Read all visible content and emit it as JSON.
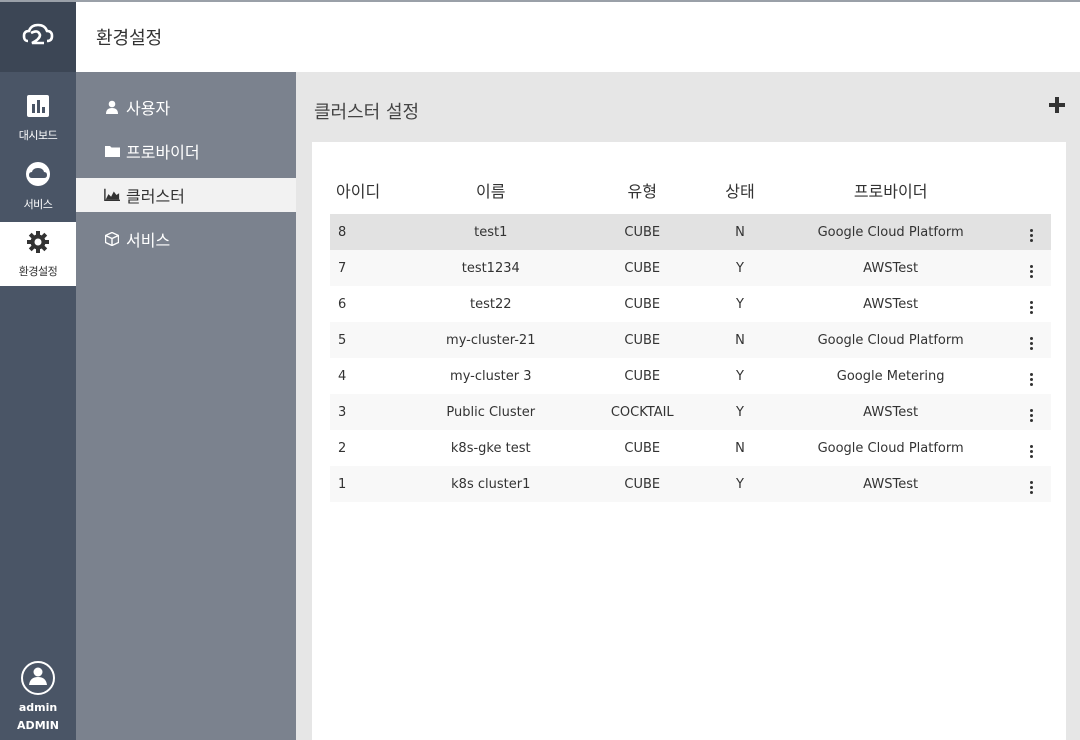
{
  "app": {
    "page_title": "환경설정"
  },
  "rail": {
    "items": [
      {
        "label": "대시보드",
        "icon": "bar-chart-icon"
      },
      {
        "label": "서비스",
        "icon": "cloud-icon"
      },
      {
        "label": "환경설정",
        "icon": "gear-icon"
      }
    ],
    "user": {
      "name": "admin",
      "role": "ADMIN"
    }
  },
  "submenu": {
    "items": [
      {
        "label": "사용자",
        "icon": "user-icon"
      },
      {
        "label": "프로바이더",
        "icon": "folder-icon"
      },
      {
        "label": "클러스터",
        "icon": "area-chart-icon"
      },
      {
        "label": "서비스",
        "icon": "cube-icon"
      }
    ],
    "active": "클러스터"
  },
  "content": {
    "title": "클러스터 설정",
    "add_icon": "plus-icon"
  },
  "table": {
    "headers": {
      "id": "아이디",
      "name": "이름",
      "type": "유형",
      "state": "상태",
      "provider": "프로바이더"
    },
    "rows": [
      {
        "id": "8",
        "name": "test1",
        "type": "CUBE",
        "state": "N",
        "provider": "Google Cloud Platform"
      },
      {
        "id": "7",
        "name": "test1234",
        "type": "CUBE",
        "state": "Y",
        "provider": "AWSTest"
      },
      {
        "id": "6",
        "name": "test22",
        "type": "CUBE",
        "state": "Y",
        "provider": "AWSTest"
      },
      {
        "id": "5",
        "name": "my-cluster-21",
        "type": "CUBE",
        "state": "N",
        "provider": "Google Cloud Platform"
      },
      {
        "id": "4",
        "name": "my-cluster 3",
        "type": "CUBE",
        "state": "Y",
        "provider": "Google Metering"
      },
      {
        "id": "3",
        "name": "Public Cluster",
        "type": "COCKTAIL",
        "state": "Y",
        "provider": "AWSTest"
      },
      {
        "id": "2",
        "name": "k8s-gke test",
        "type": "CUBE",
        "state": "N",
        "provider": "Google Cloud Platform"
      },
      {
        "id": "1",
        "name": "k8s cluster1",
        "type": "CUBE",
        "state": "Y",
        "provider": "AWSTest"
      }
    ]
  }
}
